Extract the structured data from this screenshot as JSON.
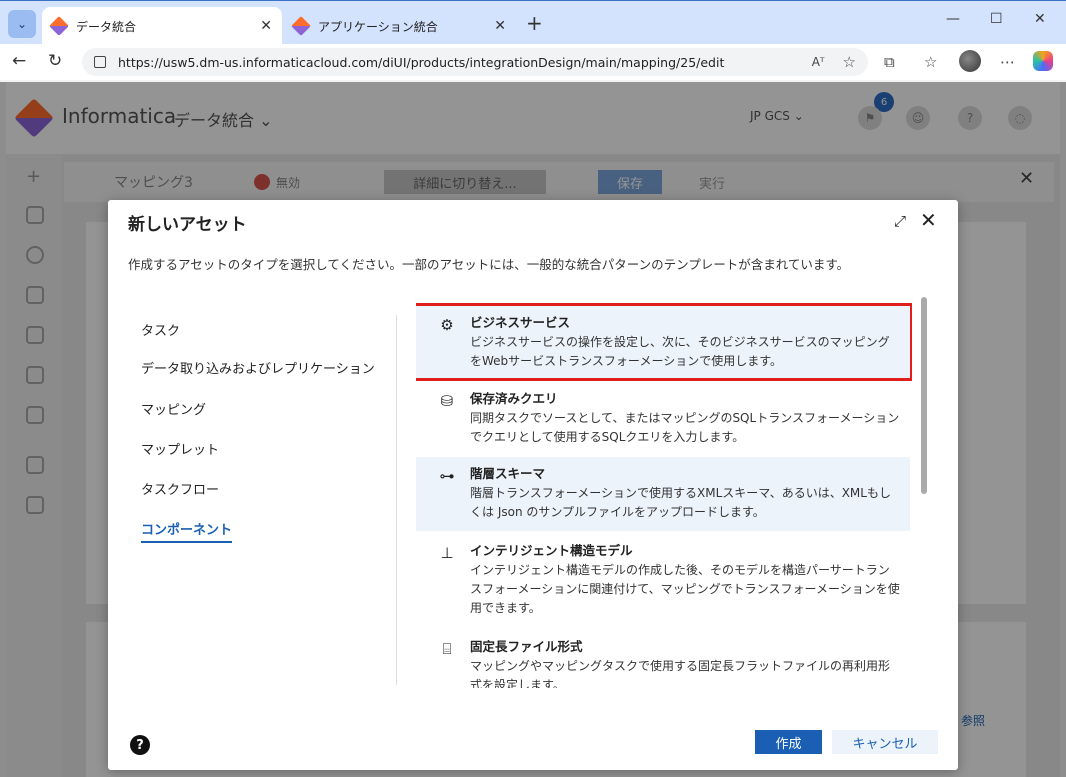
{
  "browser": {
    "tabs": [
      {
        "title": "データ統合",
        "active": true
      },
      {
        "title": "アプリケーション統合",
        "active": false
      }
    ],
    "url": "https://usw5.dm-us.informaticacloud.com/diUI/products/integrationDesign/main/mapping/25/edit",
    "reader_label": "Aᵀ",
    "colors": {
      "tabbar": "#d3e3fd",
      "accent": "#1a5fb4"
    }
  },
  "app": {
    "brand": "Informatica",
    "product": "データ統合",
    "org": "JP GCS",
    "notification_count": "6",
    "toolbar": {
      "mapping_name": "マッピング3",
      "status": "無効",
      "switch_label": "詳細に切り替え...",
      "save_label": "保存",
      "run_label": "実行"
    },
    "lower_link": "参照"
  },
  "modal": {
    "title": "新しいアセット",
    "description": "作成するアセットのタイプを選択してください。一部のアセットには、一般的な統合パターンのテンプレートが含まれています。",
    "categories": [
      {
        "label": "タスク"
      },
      {
        "label": "データ取り込みおよびレプリケーション"
      },
      {
        "label": "マッピング"
      },
      {
        "label": "マップレット"
      },
      {
        "label": "タスクフロー"
      },
      {
        "label": "コンポーネント",
        "selected": true
      }
    ],
    "assets": [
      {
        "name": "ビジネスサービス",
        "icon": "briefcase-gear-icon",
        "description": "ビジネスサービスの操作を設定し、次に、そのビジネスサービスのマッピングをWebサービストランスフォーメーションで使用します。",
        "highlighted": true,
        "boxed": true
      },
      {
        "name": "保存済みクエリ",
        "icon": "database-doc-icon",
        "description": "同期タスクでソースとして、またはマッピングのSQLトランスフォーメーションでクエリとして使用するSQLクエリを入力します。"
      },
      {
        "name": "階層スキーマ",
        "icon": "hierarchy-icon",
        "description": "階層トランスフォーメーションで使用するXMLスキーマ、あるいは、XMLもしくは Json のサンプルファイルをアップロードします。",
        "highlighted": true
      },
      {
        "name": "インテリジェント構造モデル",
        "icon": "structure-tree-icon",
        "description": "インテリジェント構造モデルの作成した後、そのモデルを構造パーサートランスフォーメーションに関連付けて、マッピングでトランスフォーメーションを使用できます。"
      },
      {
        "name": "固定長ファイル形式",
        "icon": "fixed-width-file-icon",
        "description": "マッピングやマッピングタスクで使用する固定長フラットファイルの再利用形式を設定します。"
      }
    ],
    "create_label": "作成",
    "cancel_label": "キャンセル",
    "help_symbol": "?"
  }
}
